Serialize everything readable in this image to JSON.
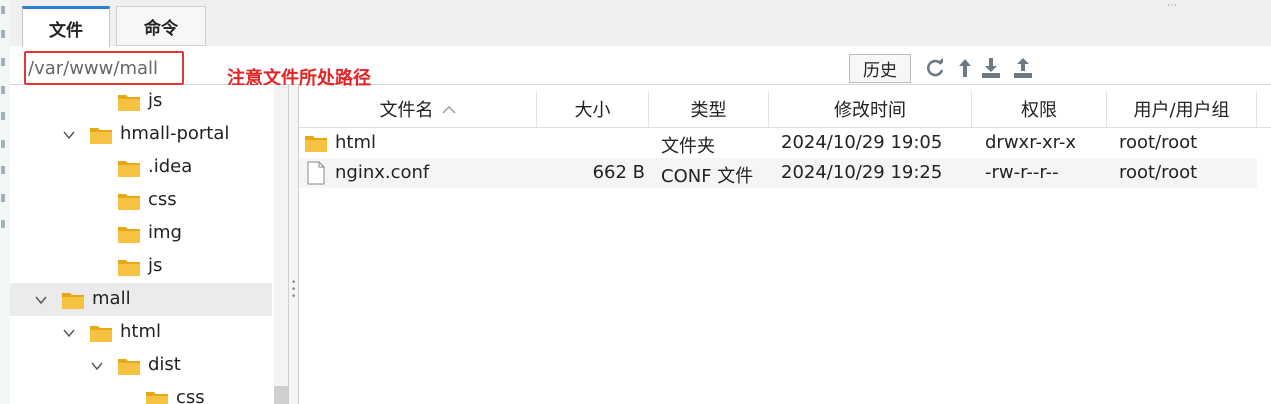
{
  "tabs": [
    {
      "label": "文件",
      "active": true
    },
    {
      "label": "命令",
      "active": false
    }
  ],
  "toolbar": {
    "path_value": "/var/www/mall",
    "annotation": "注意文件所处路径",
    "history_label": "历史",
    "icons": [
      "refresh-icon",
      "up-arrow-icon",
      "download-icon",
      "upload-icon"
    ]
  },
  "tree": [
    {
      "label": "js",
      "depth": 3,
      "expanded": null,
      "selected": false
    },
    {
      "label": "hmall-portal",
      "depth": 2,
      "expanded": true,
      "selected": false
    },
    {
      "label": ".idea",
      "depth": 3,
      "expanded": null,
      "selected": false
    },
    {
      "label": "css",
      "depth": 3,
      "expanded": null,
      "selected": false
    },
    {
      "label": "img",
      "depth": 3,
      "expanded": null,
      "selected": false
    },
    {
      "label": "js",
      "depth": 3,
      "expanded": null,
      "selected": false
    },
    {
      "label": "mall",
      "depth": 1,
      "expanded": true,
      "selected": true
    },
    {
      "label": "html",
      "depth": 2,
      "expanded": true,
      "selected": false
    },
    {
      "label": "dist",
      "depth": 3,
      "expanded": true,
      "selected": false
    },
    {
      "label": "css",
      "depth": 4,
      "expanded": null,
      "selected": false
    }
  ],
  "columns": {
    "name": "文件名",
    "size": "大小",
    "type": "类型",
    "modified": "修改时间",
    "permissions": "权限",
    "owner": "用户/用户组"
  },
  "files": [
    {
      "name": "html",
      "kind": "folder",
      "size": "",
      "type": "文件夹",
      "modified": "2024/10/29 19:05",
      "permissions": "drwxr-xr-x",
      "owner": "root/root"
    },
    {
      "name": "nginx.conf",
      "kind": "file",
      "size": "662 B",
      "type": "CONF 文件",
      "modified": "2024/10/29 19:25",
      "permissions": "-rw-r--r--",
      "owner": "root/root"
    }
  ],
  "colors": {
    "accent": "#2d7fd3",
    "annotation": "#e32424",
    "folder": "#f5c242",
    "icon": "#6c7a86"
  }
}
